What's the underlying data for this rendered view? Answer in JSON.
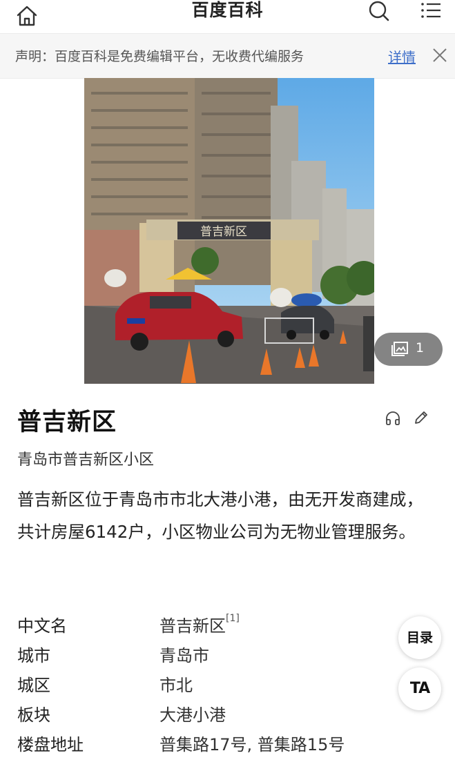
{
  "header": {
    "title": "百度百科",
    "home_icon": "home-icon",
    "search_icon": "search-icon",
    "menu_icon": "menu-icon"
  },
  "notice": {
    "text": "声明：百度百科是免费编辑平台，无收费代编服务",
    "detail_label": "详情",
    "close_icon": "close-icon"
  },
  "photo": {
    "gate_sign": "普吉新区",
    "gallery_count": "1",
    "gallery_icon": "image-gallery-icon"
  },
  "entry": {
    "title": "普吉新区",
    "subtitle": "青岛市普吉新区小区",
    "summary": "普吉新区位于青岛市市北大港小港，由无开发商建成，共计房屋6142户，小区物业公司为无物业管理服务。",
    "audio_icon": "headphones-icon",
    "edit_icon": "pencil-icon"
  },
  "infobox": {
    "rows": [
      {
        "key": "中文名",
        "value": "普吉新区",
        "ref": "[1]"
      },
      {
        "key": "城市",
        "value": "青岛市"
      },
      {
        "key": "城区",
        "value": "市北"
      },
      {
        "key": "板块",
        "value": "大港小港"
      },
      {
        "key": "楼盘地址",
        "value": "普集路17号, 普集路15号"
      }
    ]
  },
  "floating": {
    "toc_label": "目录",
    "ta_label": "TA"
  },
  "colors": {
    "link_blue": "#3d6ec9",
    "notice_bg": "#f6f6f6"
  }
}
